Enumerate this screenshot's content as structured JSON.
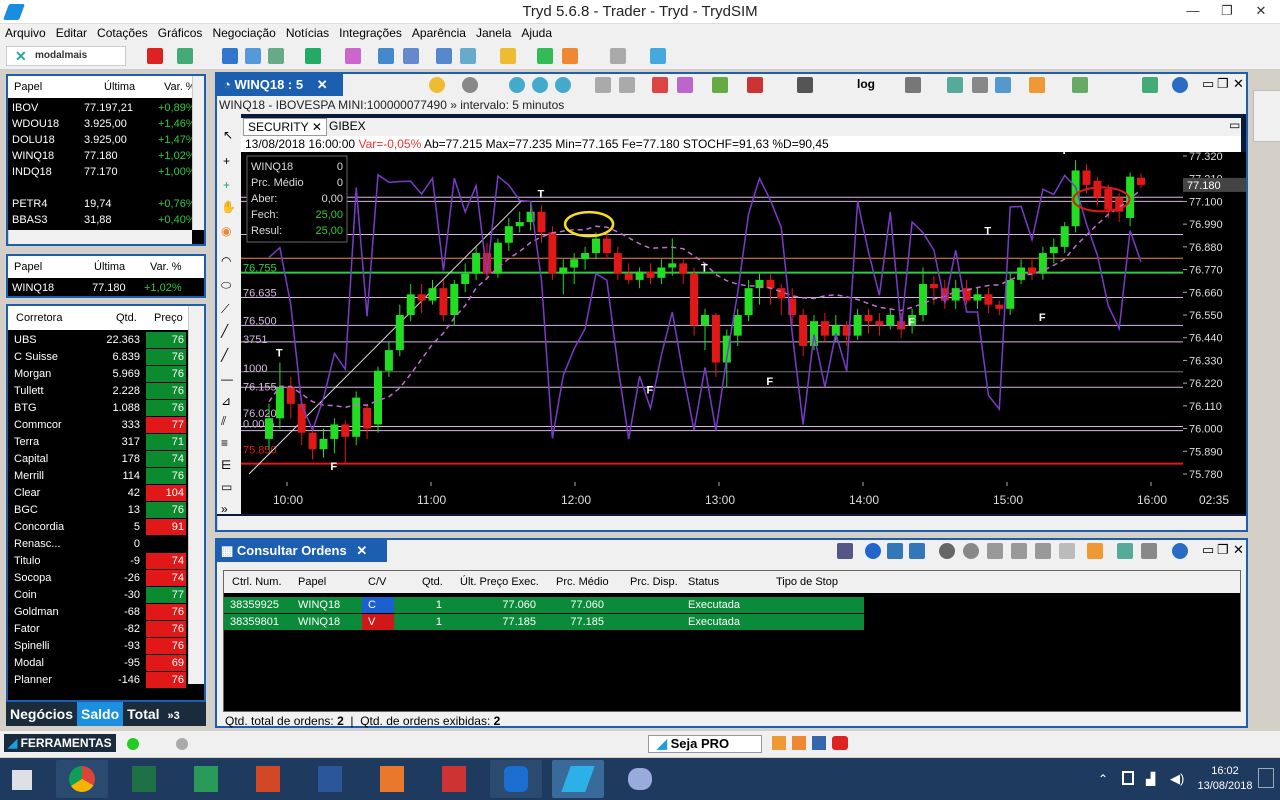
{
  "window": {
    "title": "Tryd 5.6.8 - Trader - Tryd - TrydSIM"
  },
  "menu": [
    "Arquivo",
    "Editar",
    "Cotações",
    "Gráficos",
    "Negociação",
    "Notícias",
    "Integrações",
    "Aparência",
    "Janela",
    "Ajuda"
  ],
  "logo": {
    "text": "modalmais"
  },
  "watch": {
    "headers": [
      "Papel",
      "Última",
      "Var. %"
    ],
    "rows": [
      {
        "papel": "IBOV",
        "ultima": "77.197,21",
        "var": "+0,89%"
      },
      {
        "papel": "WDOU18",
        "ultima": "3.925,00",
        "var": "+1,46%"
      },
      {
        "papel": "DOLU18",
        "ultima": "3.925,00",
        "var": "+1,47%"
      },
      {
        "papel": "WINQ18",
        "ultima": "77.180",
        "var": "+1,02%"
      },
      {
        "papel": "INDQ18",
        "ultima": "77.170",
        "var": "+1,00%"
      },
      {
        "papel": "",
        "ultima": "",
        "var": ""
      },
      {
        "papel": "PETR4",
        "ultima": "19,74",
        "var": "+0,76%"
      },
      {
        "papel": "BBAS3",
        "ultima": "31,88",
        "var": "+0,40%"
      }
    ]
  },
  "quote": {
    "headers": [
      "Papel",
      "Última",
      "Var. %"
    ],
    "papel": "WINQ18",
    "ultima": "77.180",
    "var": "+1,02%"
  },
  "brokers": {
    "headers": [
      "Corretora",
      "Qtd.",
      "Preço"
    ],
    "rows": [
      {
        "nome": "UBS",
        "qtd": "22.363",
        "preco": "76",
        "cor": "green"
      },
      {
        "nome": "C Suisse",
        "qtd": "6.839",
        "preco": "76",
        "cor": "green"
      },
      {
        "nome": "Morgan",
        "qtd": "5.969",
        "preco": "76",
        "cor": "green"
      },
      {
        "nome": "Tullett",
        "qtd": "2.228",
        "preco": "76",
        "cor": "green"
      },
      {
        "nome": "BTG",
        "qtd": "1.088",
        "preco": "76",
        "cor": "green"
      },
      {
        "nome": "Commcor",
        "qtd": "333",
        "preco": "77",
        "cor": "red"
      },
      {
        "nome": "Terra",
        "qtd": "317",
        "preco": "71",
        "cor": "green"
      },
      {
        "nome": "Capital",
        "qtd": "178",
        "preco": "74",
        "cor": "green"
      },
      {
        "nome": "Merrill",
        "qtd": "114",
        "preco": "76",
        "cor": "green"
      },
      {
        "nome": "Clear",
        "qtd": "42",
        "preco": "104",
        "cor": "red"
      },
      {
        "nome": "BGC",
        "qtd": "13",
        "preco": "76",
        "cor": "green"
      },
      {
        "nome": "Concordia",
        "qtd": "5",
        "preco": "91",
        "cor": "red"
      },
      {
        "nome": "Renasc...",
        "qtd": "0",
        "preco": "",
        "cor": "none"
      },
      {
        "nome": "Titulo",
        "qtd": "-9",
        "preco": "74",
        "cor": "red"
      },
      {
        "nome": "Socopa",
        "qtd": "-26",
        "preco": "74",
        "cor": "red"
      },
      {
        "nome": "Coin",
        "qtd": "-30",
        "preco": "77",
        "cor": "green"
      },
      {
        "nome": "Goldman",
        "qtd": "-68",
        "preco": "76",
        "cor": "red"
      },
      {
        "nome": "Fator",
        "qtd": "-82",
        "preco": "76",
        "cor": "red"
      },
      {
        "nome": "Spinelli",
        "qtd": "-93",
        "preco": "76",
        "cor": "red"
      },
      {
        "nome": "Modal",
        "qtd": "-95",
        "preco": "69",
        "cor": "red"
      },
      {
        "nome": "Planner",
        "qtd": "-146",
        "preco": "76",
        "cor": "red"
      }
    ]
  },
  "bottom_tabs": [
    "Negócios",
    "Saldo",
    "Total",
    "»3"
  ],
  "chart": {
    "tab": "WINQ18 : 5",
    "subtitle": "WINQ18 - IBOVESPA MINI:100000077490 » intervalo: 5 minutos",
    "subtabs": [
      "SECURITY",
      "GIBEX"
    ],
    "info": {
      "date": "13/08/2018 16:00:00",
      "var": "Var=-0,05%",
      "ab": "Ab=77.215",
      "max": "Max=77.235",
      "min": "Min=77.165",
      "fe": "Fe=77.180",
      "stoch": "STOCHF=91,63",
      "d": "%D=90,45"
    },
    "box": {
      "symbol": "WINQ18",
      "symbol_val": "0",
      "prc_medio": "Prc. Médio",
      "prc_medio_val": "0",
      "aber": "Aber:",
      "aber_val": "0,00",
      "fech": "Fech:",
      "fech_val": "25,00",
      "resul": "Resul:",
      "resul_val": "25,00"
    },
    "level_labels": [
      "76.755",
      "76.635",
      "76.500",
      "3751",
      "1000",
      "76.155",
      "76.020",
      "0.00%",
      "75.850"
    ],
    "y_ticks": [
      "77.320",
      "77.210",
      "77.100",
      "76.990",
      "76.880",
      "76.770",
      "76.660",
      "76.550",
      "76.440",
      "76.330",
      "76.220",
      "76.110",
      "76.000",
      "75.890",
      "75.780"
    ],
    "last_price": "77.180",
    "x_ticks": [
      "10:00",
      "11:00",
      "12:00",
      "13:00",
      "14:00",
      "15:00",
      "16:00"
    ],
    "time_right": "02:35",
    "markers": [
      "T",
      "T",
      "T",
      "T",
      "T",
      "F",
      "F",
      "F",
      "F",
      "F"
    ],
    "candles": [
      {
        "o": 75.95,
        "c": 76.05,
        "h": 76.12,
        "l": 75.9
      },
      {
        "o": 76.05,
        "c": 76.2,
        "h": 76.32,
        "l": 76.0
      },
      {
        "o": 76.2,
        "c": 76.12,
        "h": 76.25,
        "l": 76.05
      },
      {
        "o": 76.12,
        "c": 75.98,
        "h": 76.15,
        "l": 75.92
      },
      {
        "o": 75.98,
        "c": 75.9,
        "h": 76.0,
        "l": 75.85
      },
      {
        "o": 75.9,
        "c": 75.95,
        "h": 76.0,
        "l": 75.86
      },
      {
        "o": 75.95,
        "c": 76.02,
        "h": 76.05,
        "l": 75.88
      },
      {
        "o": 76.02,
        "c": 75.96,
        "h": 76.04,
        "l": 75.83
      },
      {
        "o": 75.96,
        "c": 76.15,
        "h": 76.18,
        "l": 75.92
      },
      {
        "o": 76.1,
        "c": 76.0,
        "h": 76.12,
        "l": 75.95
      },
      {
        "o": 76.02,
        "c": 76.28,
        "h": 76.3,
        "l": 75.98
      },
      {
        "o": 76.28,
        "c": 76.38,
        "h": 76.42,
        "l": 76.25
      },
      {
        "o": 76.38,
        "c": 76.55,
        "h": 76.6,
        "l": 76.35
      },
      {
        "o": 76.55,
        "c": 76.65,
        "h": 76.7,
        "l": 76.52
      },
      {
        "o": 76.65,
        "c": 76.62,
        "h": 76.7,
        "l": 76.56
      },
      {
        "o": 76.62,
        "c": 76.68,
        "h": 76.72,
        "l": 76.6
      },
      {
        "o": 76.68,
        "c": 76.55,
        "h": 76.72,
        "l": 76.52
      },
      {
        "o": 76.55,
        "c": 76.7,
        "h": 76.72,
        "l": 76.5
      },
      {
        "o": 76.7,
        "c": 76.75,
        "h": 76.8,
        "l": 76.66
      },
      {
        "o": 76.75,
        "c": 76.85,
        "h": 76.88,
        "l": 76.72
      },
      {
        "o": 76.85,
        "c": 76.75,
        "h": 76.9,
        "l": 76.72
      },
      {
        "o": 76.75,
        "c": 76.9,
        "h": 76.92,
        "l": 76.73
      },
      {
        "o": 76.9,
        "c": 76.98,
        "h": 77.02,
        "l": 76.86
      },
      {
        "o": 76.98,
        "c": 77.0,
        "h": 77.05,
        "l": 76.95
      },
      {
        "o": 77.0,
        "c": 77.05,
        "h": 77.1,
        "l": 76.96
      },
      {
        "o": 77.05,
        "c": 76.95,
        "h": 77.08,
        "l": 76.9
      },
      {
        "o": 76.95,
        "c": 76.75,
        "h": 76.98,
        "l": 76.72
      },
      {
        "o": 76.75,
        "c": 76.78,
        "h": 76.82,
        "l": 76.65
      },
      {
        "o": 76.78,
        "c": 76.82,
        "h": 76.85,
        "l": 76.7
      },
      {
        "o": 76.82,
        "c": 76.85,
        "h": 76.88,
        "l": 76.77
      },
      {
        "o": 76.85,
        "c": 76.92,
        "h": 76.95,
        "l": 76.82
      },
      {
        "o": 76.92,
        "c": 76.85,
        "h": 76.96,
        "l": 76.82
      },
      {
        "o": 76.85,
        "c": 76.75,
        "h": 76.88,
        "l": 76.72
      },
      {
        "o": 76.75,
        "c": 76.72,
        "h": 76.8,
        "l": 76.7
      },
      {
        "o": 76.72,
        "c": 76.76,
        "h": 76.78,
        "l": 76.68
      },
      {
        "o": 76.76,
        "c": 76.73,
        "h": 76.8,
        "l": 76.7
      },
      {
        "o": 76.73,
        "c": 76.78,
        "h": 76.82,
        "l": 76.7
      },
      {
        "o": 76.78,
        "c": 76.8,
        "h": 76.92,
        "l": 76.74
      },
      {
        "o": 76.8,
        "c": 76.75,
        "h": 76.82,
        "l": 76.7
      },
      {
        "o": 76.75,
        "c": 76.5,
        "h": 76.78,
        "l": 76.45
      },
      {
        "o": 76.5,
        "c": 76.55,
        "h": 76.58,
        "l": 76.38
      },
      {
        "o": 76.55,
        "c": 76.32,
        "h": 76.56,
        "l": 76.25
      },
      {
        "o": 76.32,
        "c": 76.45,
        "h": 76.48,
        "l": 76.2
      },
      {
        "o": 76.45,
        "c": 76.55,
        "h": 76.58,
        "l": 76.4
      },
      {
        "o": 76.55,
        "c": 76.68,
        "h": 76.72,
        "l": 76.52
      },
      {
        "o": 76.68,
        "c": 76.72,
        "h": 76.75,
        "l": 76.6
      },
      {
        "o": 76.72,
        "c": 76.68,
        "h": 76.75,
        "l": 76.6
      },
      {
        "o": 76.68,
        "c": 76.63,
        "h": 76.7,
        "l": 76.55
      },
      {
        "o": 76.63,
        "c": 76.55,
        "h": 76.68,
        "l": 76.5
      },
      {
        "o": 76.55,
        "c": 76.4,
        "h": 76.58,
        "l": 76.35
      },
      {
        "o": 76.4,
        "c": 76.52,
        "h": 76.55,
        "l": 76.38
      },
      {
        "o": 76.52,
        "c": 76.45,
        "h": 76.56,
        "l": 76.42
      },
      {
        "o": 76.45,
        "c": 76.5,
        "h": 76.55,
        "l": 76.42
      },
      {
        "o": 76.5,
        "c": 76.45,
        "h": 76.52,
        "l": 76.4
      },
      {
        "o": 76.45,
        "c": 76.55,
        "h": 76.58,
        "l": 76.43
      },
      {
        "o": 76.55,
        "c": 76.52,
        "h": 76.58,
        "l": 76.46
      },
      {
        "o": 76.52,
        "c": 76.5,
        "h": 76.56,
        "l": 76.45
      },
      {
        "o": 76.5,
        "c": 76.55,
        "h": 76.58,
        "l": 76.48
      },
      {
        "o": 76.52,
        "c": 76.48,
        "h": 76.56,
        "l": 76.44
      },
      {
        "o": 76.5,
        "c": 76.55,
        "h": 76.58,
        "l": 76.46
      },
      {
        "o": 76.55,
        "c": 76.7,
        "h": 76.78,
        "l": 76.52
      },
      {
        "o": 76.7,
        "c": 76.68,
        "h": 76.74,
        "l": 76.6
      },
      {
        "o": 76.68,
        "c": 76.62,
        "h": 76.72,
        "l": 76.58
      },
      {
        "o": 76.62,
        "c": 76.68,
        "h": 76.72,
        "l": 76.58
      },
      {
        "o": 76.68,
        "c": 76.62,
        "h": 76.72,
        "l": 76.6
      },
      {
        "o": 76.62,
        "c": 76.65,
        "h": 76.68,
        "l": 76.58
      },
      {
        "o": 76.65,
        "c": 76.6,
        "h": 76.68,
        "l": 76.56
      },
      {
        "o": 76.6,
        "c": 76.58,
        "h": 76.62,
        "l": 76.55
      },
      {
        "o": 76.58,
        "c": 76.72,
        "h": 76.75,
        "l": 76.55
      },
      {
        "o": 76.72,
        "c": 76.78,
        "h": 76.82,
        "l": 76.7
      },
      {
        "o": 76.78,
        "c": 76.75,
        "h": 76.82,
        "l": 76.72
      },
      {
        "o": 76.75,
        "c": 76.85,
        "h": 76.88,
        "l": 76.72
      },
      {
        "o": 76.85,
        "c": 76.88,
        "h": 76.92,
        "l": 76.8
      },
      {
        "o": 76.88,
        "c": 76.98,
        "h": 77.0,
        "l": 76.85
      },
      {
        "o": 76.98,
        "c": 77.25,
        "h": 77.3,
        "l": 76.95
      },
      {
        "o": 77.25,
        "c": 77.18,
        "h": 77.28,
        "l": 77.14
      },
      {
        "o": 77.2,
        "c": 77.12,
        "h": 77.22,
        "l": 77.08
      },
      {
        "o": 77.16,
        "c": 77.06,
        "h": 77.18,
        "l": 77.02
      },
      {
        "o": 77.12,
        "c": 77.05,
        "h": 77.14,
        "l": 77.0
      },
      {
        "o": 77.02,
        "c": 77.22,
        "h": 77.24,
        "l": 76.98
      },
      {
        "o": 77.215,
        "c": 77.18,
        "h": 77.235,
        "l": 77.165
      }
    ]
  },
  "orders": {
    "title": "Consultar Ordens",
    "headers": [
      "Ctrl. Num.",
      "Papel",
      "C/V",
      "Qtd.",
      "Últ. Preço Exec.",
      "Prc. Médio",
      "Prc. Disp.",
      "Status",
      "Tipo de Stop"
    ],
    "rows": [
      {
        "ctrl": "38359925",
        "papel": "WINQ18",
        "cv": "C",
        "qtd": "1",
        "ult": "77.060",
        "medio": "77.060",
        "disp": "",
        "status": "Executada",
        "stop": ""
      },
      {
        "ctrl": "38359801",
        "papel": "WINQ18",
        "cv": "V",
        "qtd": "1",
        "ult": "77.185",
        "medio": "77.185",
        "disp": "",
        "status": "Executada",
        "stop": ""
      }
    ],
    "footer_total": "Qtd. total de ordens:",
    "footer_total_val": "2",
    "footer_exib": "Qtd. de ordens exibidas:",
    "footer_exib_val": "2"
  },
  "tools": {
    "label": "FERRAMENTAS",
    "seja_pro": "Seja PRO"
  },
  "clock": {
    "time": "16:02",
    "date": "13/08/2018"
  }
}
